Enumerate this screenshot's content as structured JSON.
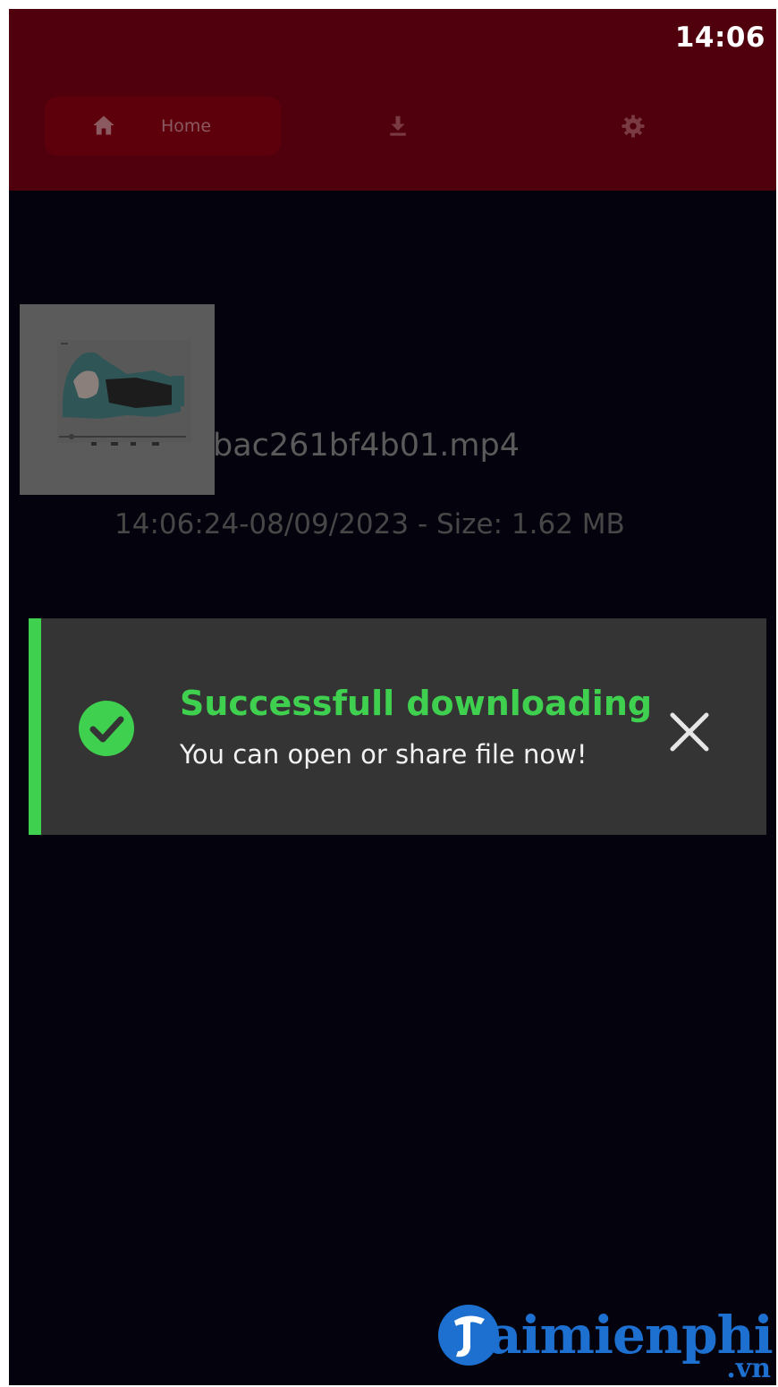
{
  "status_bar": {
    "time": "14:06"
  },
  "nav": {
    "home_label": "Home",
    "icons": [
      "home-icon",
      "download-icon",
      "gear-icon"
    ]
  },
  "download_item": {
    "filename": "bac261bf4b01.mp4",
    "meta": "14:06:24-08/09/2023 - Size: 1.62 MB"
  },
  "toast": {
    "title": "Successfull downloading",
    "message": "You can open or share file now!",
    "icon": "check-circle-icon",
    "close_icon": "close-icon"
  },
  "watermark": {
    "text": "aimienphi",
    "tld": ".vn"
  },
  "colors": {
    "topbar": "#4f000c",
    "nav_home": "#5d000c",
    "background": "#03020d",
    "toast_bg": "#343434",
    "success": "#3fd04f",
    "watermark": "#1d6fd0"
  }
}
